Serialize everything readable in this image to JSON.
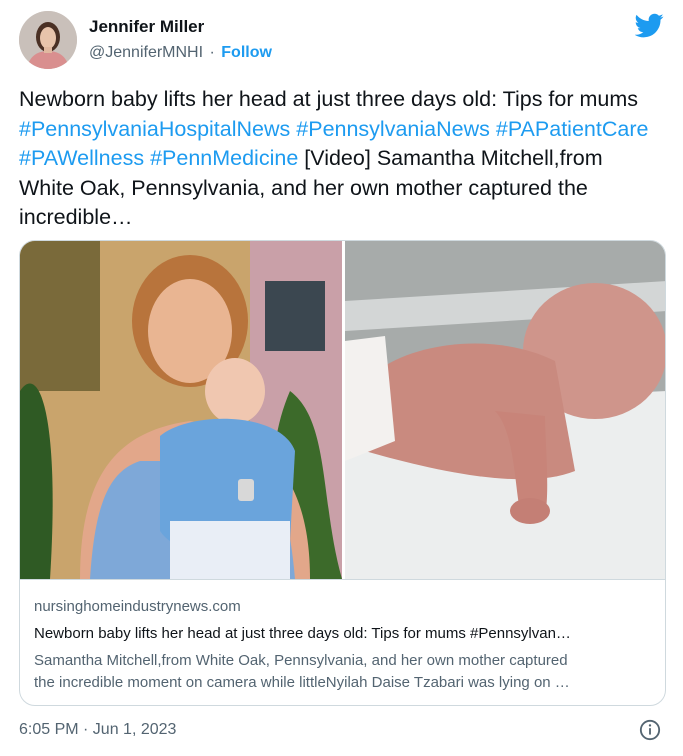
{
  "author": {
    "name": "Jennifer Miller",
    "handle": "@JenniferMNHI",
    "separator": "·",
    "follow_label": "Follow"
  },
  "tweet": {
    "text_intro": "Newborn baby lifts her head at just three days old: Tips for mums",
    "hashtags": [
      "#PennsylvaniaHospitalNews",
      "#PennsylvaniaNews",
      "#PAPatientCare",
      "#PAWellness",
      "#PennMedicine"
    ],
    "text_tail_1": "[Video]",
    "text_tail_2": "Samantha Mitchell,from White Oak, Pennsylvania, and her own mother captured the incredible…"
  },
  "card": {
    "domain": "nursinghomeindustrynews.com",
    "title": "Newborn baby lifts her head at just three days old: Tips for mums #Pennsylvan…",
    "description_line1": "Samantha Mitchell,from White Oak, Pennsylvania, and her own mother captured",
    "description_line2": "the incredible moment on camera while littleNyilah Daise Tzabari was lying on …"
  },
  "footer": {
    "timestamp": "6:05 PM · Jun 1, 2023"
  },
  "colors": {
    "accent": "#1d9bf0",
    "text_primary": "#0f1419",
    "text_secondary": "#536471",
    "border": "#cfd9de"
  },
  "icons": {
    "brand": "twitter-bird-icon",
    "info": "info-icon"
  }
}
